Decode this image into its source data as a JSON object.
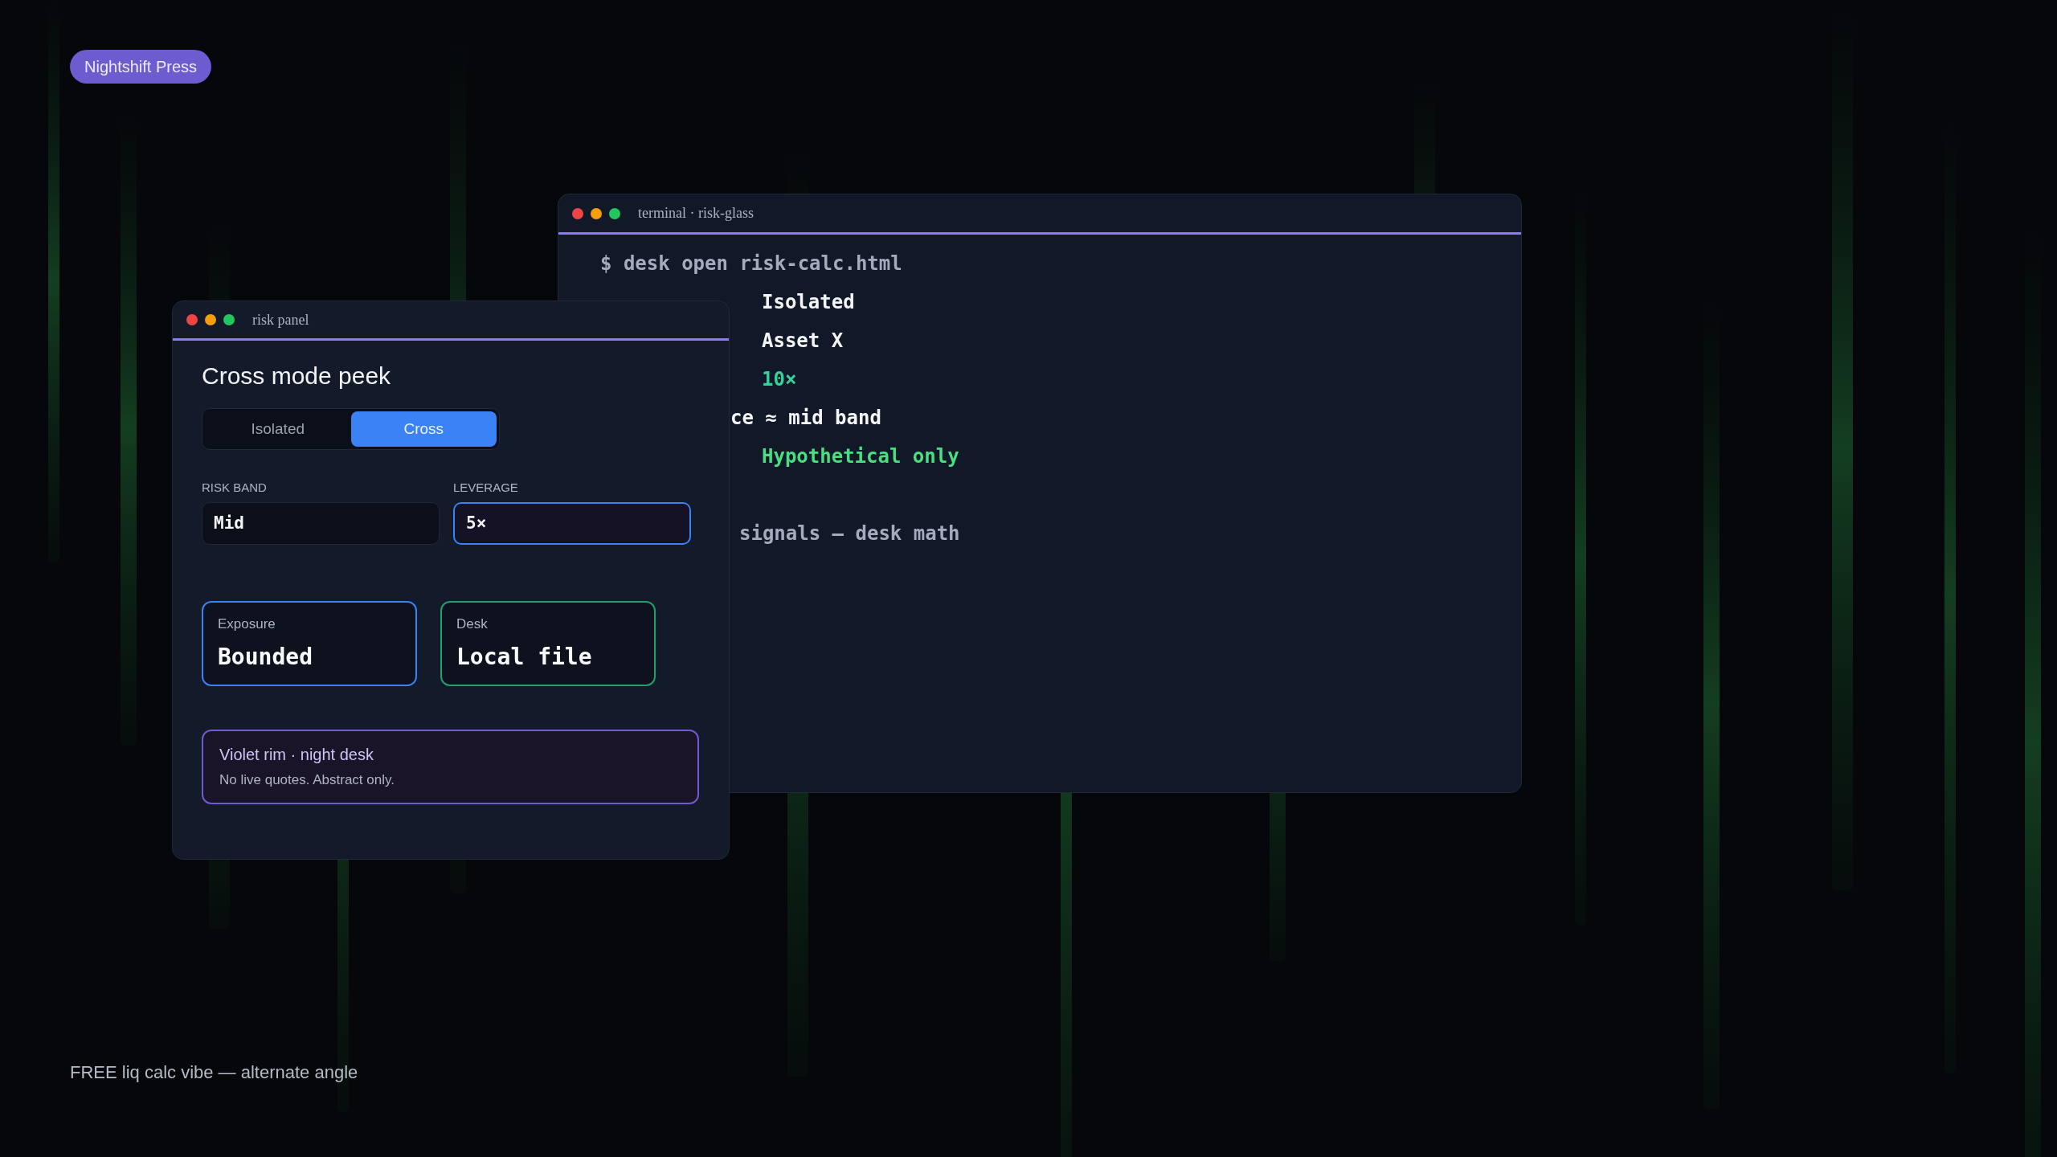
{
  "badge": "Nightshift Press",
  "terminal": {
    "title": "terminal · risk-glass",
    "lines": [
      {
        "kind": "command",
        "text": "$ desk open risk-calc.html",
        "color": "#a3acbd"
      },
      {
        "kind": "value",
        "text": "Isolated",
        "color": "#f3f4f6"
      },
      {
        "kind": "value",
        "text": "Asset X",
        "color": "#f3f4f6"
      },
      {
        "kind": "value",
        "text": "10×",
        "color": "#34d399"
      },
      {
        "kind": "tail",
        "text": "ce ≈ mid band",
        "color": "#f3f4f6"
      },
      {
        "kind": "value",
        "text": "Hypothetical only",
        "color": "#4ade80"
      },
      {
        "kind": "blank"
      },
      {
        "kind": "note",
        "text": "signals — desk math",
        "color": "#a3acbd"
      }
    ]
  },
  "panel": {
    "title": "risk panel",
    "heading": "Cross mode peek",
    "modes": [
      {
        "label": "Isolated",
        "selected": false
      },
      {
        "label": "Cross",
        "selected": true
      }
    ],
    "fields": [
      {
        "label": "RISK BAND",
        "value": "Mid",
        "focused": false
      },
      {
        "label": "LEVERAGE",
        "value": "5×",
        "focused": true
      }
    ],
    "cards": [
      {
        "label": "Exposure",
        "value": "Bounded",
        "color": "#3b82f6"
      },
      {
        "label": "Desk",
        "value": "Local file",
        "color": "#22a06b"
      }
    ],
    "note": {
      "title": "Violet rim · night desk",
      "text": "No live quotes. Abstract only."
    }
  },
  "footer": "FREE liq calc vibe — alternate angle"
}
